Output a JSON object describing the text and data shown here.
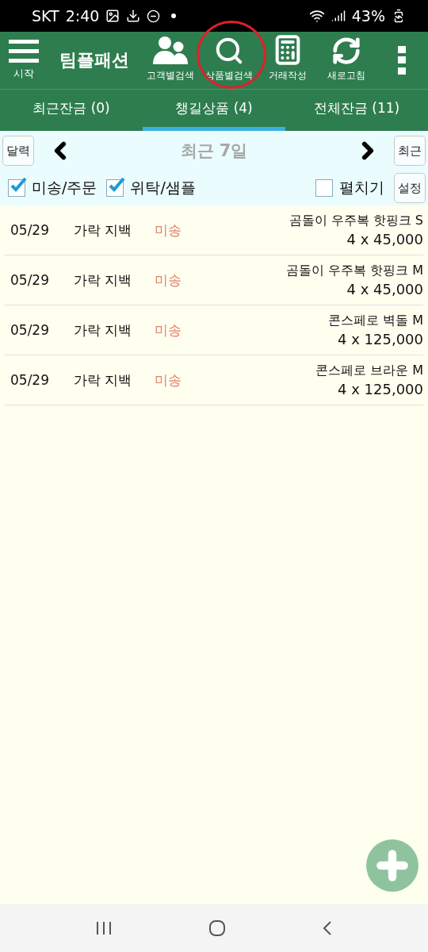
{
  "status_bar": {
    "carrier": "SKT",
    "time": "2:40",
    "battery": "43%"
  },
  "toolbar": {
    "menu_label": "시작",
    "title": "팀플패션",
    "actions": [
      {
        "kind": "people",
        "label": "고객별검색",
        "highlighted": false
      },
      {
        "kind": "search",
        "label": "상품별검색",
        "highlighted": true
      },
      {
        "kind": "calculator",
        "label": "거래작성",
        "highlighted": false
      },
      {
        "kind": "refresh",
        "label": "새로고침",
        "highlighted": false
      }
    ]
  },
  "tabs": [
    {
      "label": "최근잔금 (0)",
      "selected": false
    },
    {
      "label": "챙길상품 (4)",
      "selected": true
    },
    {
      "label": "전체잔금 (11)",
      "selected": false
    }
  ],
  "date_nav": {
    "calendar_button": "달력",
    "period": "최근 7일",
    "recent_button": "최근"
  },
  "filters": [
    {
      "label": "미송/주문",
      "checked": true
    },
    {
      "label": "위탁/샘플",
      "checked": true
    }
  ],
  "expand": {
    "label": "펼치기",
    "checked": false
  },
  "settings_button": "설정",
  "rows": [
    {
      "date": "05/29",
      "customer": "가락 지백",
      "status": "미송",
      "product": "곰돌이 우주복 핫핑크 S",
      "quantity": "4 x 45,000"
    },
    {
      "date": "05/29",
      "customer": "가락 지백",
      "status": "미송",
      "product": "곰돌이 우주복 핫핑크 M",
      "quantity": "4 x 45,000"
    },
    {
      "date": "05/29",
      "customer": "가락 지백",
      "status": "미송",
      "product": "콘스페로 벽돌 M",
      "quantity": "4 x 125,000"
    },
    {
      "date": "05/29",
      "customer": "가락 지백",
      "status": "미송",
      "product": "콘스페로 브라운 M",
      "quantity": "4 x 125,000"
    }
  ]
}
